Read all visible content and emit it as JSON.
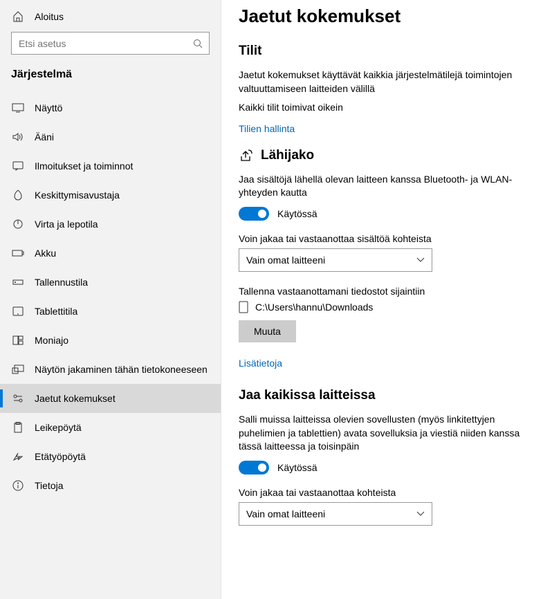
{
  "sidebar": {
    "home": "Aloitus",
    "search_placeholder": "Etsi asetus",
    "category": "Järjestelmä",
    "items": [
      {
        "label": "Näyttö"
      },
      {
        "label": "Ääni"
      },
      {
        "label": "Ilmoitukset ja toiminnot"
      },
      {
        "label": "Keskittymisavustaja"
      },
      {
        "label": "Virta ja lepotila"
      },
      {
        "label": "Akku"
      },
      {
        "label": "Tallennustila"
      },
      {
        "label": "Tablettitila"
      },
      {
        "label": "Moniajo"
      },
      {
        "label": "Näytön jakaminen tähän tietokoneeseen"
      },
      {
        "label": "Jaetut kokemukset"
      },
      {
        "label": "Leikepöytä"
      },
      {
        "label": "Etätyöpöytä"
      },
      {
        "label": "Tietoja"
      }
    ]
  },
  "main": {
    "title": "Jaetut kokemukset",
    "accounts": {
      "heading": "Tilit",
      "desc": "Jaetut kokemukset käyttävät kaikkia järjestelmätilejä toimintojen valtuuttamiseen laitteiden välillä",
      "status": "Kaikki tilit toimivat oikein",
      "link": "Tilien hallinta"
    },
    "nearby": {
      "heading": "Lähijako",
      "desc": "Jaa sisältöjä lähellä olevan laitteen kanssa Bluetooth- ja WLAN-yhteyden kautta",
      "toggle_state": "Käytössä",
      "share_label": "Voin jakaa tai vastaanottaa sisältöä kohteista",
      "share_value": "Vain omat laitteeni",
      "save_label": "Tallenna vastaanottamani tiedostot sijaintiin",
      "save_path": "C:\\Users\\hannu\\Downloads",
      "change_btn": "Muuta",
      "more_link": "Lisätietoja"
    },
    "alldev": {
      "heading": "Jaa kaikissa laitteissa",
      "desc": "Salli muissa laitteissa olevien sovellusten (myös linkitettyjen puhelimien ja tablettien) avata sovelluksia ja viestiä niiden kanssa tässä laitteessa ja toisinpäin",
      "toggle_state": "Käytössä",
      "share_label": "Voin jakaa tai vastaanottaa kohteista",
      "share_value": "Vain omat laitteeni"
    }
  }
}
